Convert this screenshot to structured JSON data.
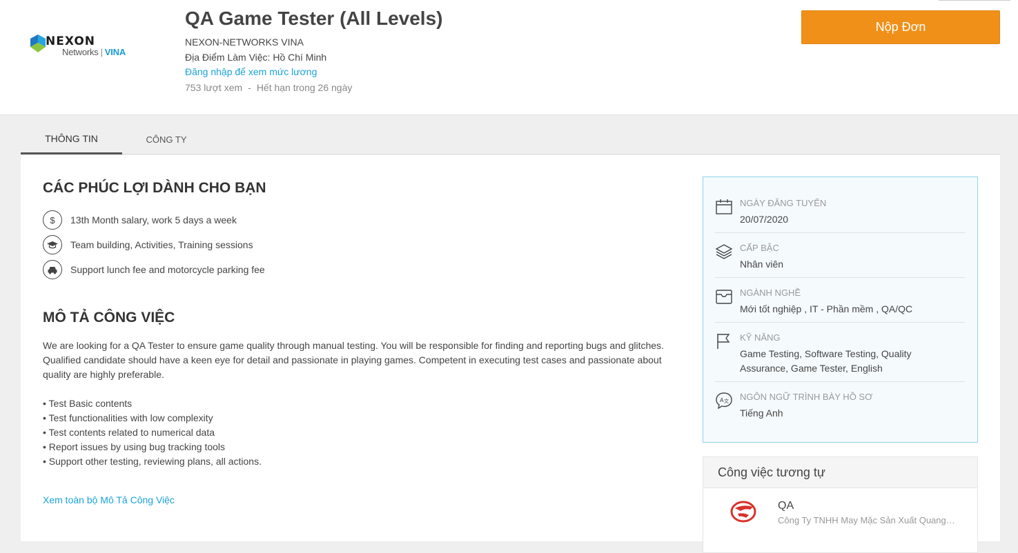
{
  "header": {
    "logo": {
      "word": "NEXON",
      "sub_left": "Networks",
      "sub_right": "VINA"
    },
    "job_title": "QA Game Tester (All Levels)",
    "company": "NEXON-NETWORKS VINA",
    "location": "Địa Điểm Làm Việc: Hồ Chí Minh",
    "salary_link": "Đăng nhập để xem mức lương",
    "views": "753 lượt xem",
    "separator": "-",
    "expires": "Hết hạn trong 26 ngày",
    "apply_label": "Nộp Đơn"
  },
  "tabs": [
    {
      "label": "THÔNG TIN"
    },
    {
      "label": "CÔNG TY"
    }
  ],
  "benefits": {
    "title": "CÁC PHÚC LỢI DÀNH CHO BẠN",
    "items": [
      {
        "icon": "dollar-icon",
        "text": "13th Month salary, work 5 days a week"
      },
      {
        "icon": "graduation-cap-icon",
        "text": "Team building, Activities, Training sessions"
      },
      {
        "icon": "car-icon",
        "text": "Support lunch fee and motorcycle parking fee"
      }
    ]
  },
  "description": {
    "title": "MÔ TẢ CÔNG VIỆC",
    "para1": "We are looking for a QA Tester to ensure game quality through manual testing. You will be responsible for finding and reporting bugs and glitches.",
    "para2": "Qualified candidate should have a keen eye for detail and passionate in playing games. Competent in executing test cases and passionate about quality are highly preferable.",
    "bullets": [
      "• Test Basic contents",
      "• Test functionalities with low complexity",
      "• Test contents related to numerical data",
      "• Report issues by using bug tracking tools",
      "• Support other testing, reviewing plans, all actions."
    ],
    "more_link": "Xem toàn bộ Mô Tả Công Việc"
  },
  "summary": [
    {
      "icon": "calendar-icon",
      "label": "NGÀY ĐĂNG TUYỂN",
      "value": "20/07/2020"
    },
    {
      "icon": "layers-icon",
      "label": "CẤP BẬC",
      "value": "Nhân viên"
    },
    {
      "icon": "briefcase-icon",
      "label": "NGÀNH NGHỀ",
      "value": "Mới tốt nghiệp ,  IT - Phần mềm ,  QA/QC"
    },
    {
      "icon": "flag-icon",
      "label": "KỸ NĂNG",
      "value": "Game Testing, Software Testing, Quality Assurance, Game Tester, English"
    },
    {
      "icon": "language-icon",
      "label": "NGÔN NGỮ TRÌNH BÀY HỒ SƠ",
      "value": "Tiếng Anh"
    }
  ],
  "similar": {
    "title": "Công việc tương tự",
    "items": [
      {
        "title": "QA",
        "company": "Công Ty TNHH May Mặc Sản Xuất Quang Thái"
      }
    ]
  },
  "colors": {
    "accent_orange": "#f09019",
    "link_blue": "#1aa3d9",
    "summary_border": "#8fd3e8"
  }
}
